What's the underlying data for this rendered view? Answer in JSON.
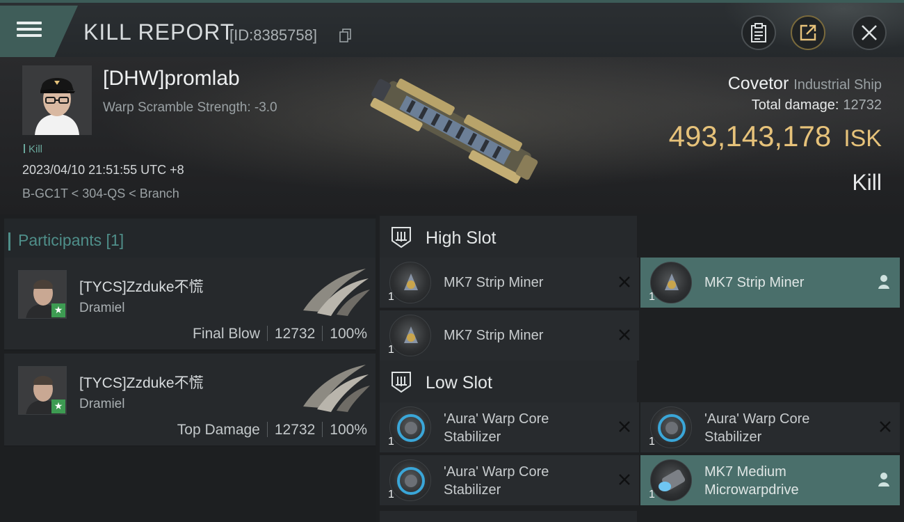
{
  "header": {
    "title": "KILL REPORT",
    "id_label": "[ID:8385758]"
  },
  "victim": {
    "name": "[DHW]promlab",
    "subtitle": "Warp Scramble Strength: -3.0",
    "tag": "Kill",
    "timestamp": "2023/04/10 21:51:55 UTC +8",
    "location": "B-GC1T < 304-QS < Branch",
    "ship_name": "Covetor",
    "ship_class": "Industrial Ship",
    "total_damage_label": "Total damage:",
    "total_damage_value": "12732",
    "isk_value": "493,143,178",
    "isk_unit": "ISK",
    "result": "Kill"
  },
  "participants": {
    "title": "Participants [1]",
    "items": [
      {
        "name": "[TYCS]Zzduke不慌",
        "ship": "Dramiel",
        "role": "Final Blow",
        "damage": "12732",
        "percent": "100%"
      },
      {
        "name": "[TYCS]Zzduke不慌",
        "ship": "Dramiel",
        "role": "Top Damage",
        "damage": "12732",
        "percent": "100%"
      }
    ]
  },
  "fitting": {
    "high_slot": {
      "label": "High Slot",
      "modules": [
        {
          "qty": "1",
          "name_line1": "MK7 Strip Miner",
          "name_line2": "",
          "status": "destroyed"
        },
        {
          "qty": "1",
          "name_line1": "MK7 Strip Miner",
          "name_line2": "",
          "status": "dropped"
        },
        {
          "qty": "1",
          "name_line1": "MK7 Strip Miner",
          "name_line2": "",
          "status": "destroyed"
        }
      ]
    },
    "low_slot": {
      "label": "Low Slot",
      "modules": [
        {
          "qty": "1",
          "name_line1": "'Aura' Warp Core",
          "name_line2": "Stabilizer",
          "status": "destroyed"
        },
        {
          "qty": "1",
          "name_line1": "'Aura' Warp Core",
          "name_line2": "Stabilizer",
          "status": "destroyed"
        },
        {
          "qty": "1",
          "name_line1": "'Aura' Warp Core",
          "name_line2": "Stabilizer",
          "status": "destroyed"
        },
        {
          "qty": "1",
          "name_line1": "MK7 Medium",
          "name_line2": "Microwarpdrive",
          "status": "dropped"
        }
      ]
    }
  },
  "icons": {
    "menu": "hamburger-icon",
    "copy": "copy-icon",
    "clipboard": "clipboard-icon",
    "share": "share-icon",
    "close": "close-icon",
    "destroyed": "x-icon",
    "dropped": "person-icon",
    "high_slot": "high-slot-icon",
    "low_slot": "low-slot-icon"
  },
  "colors": {
    "accent_teal": "#4f8f8a",
    "isk_gold": "#e6c27a",
    "dropped_highlight": "#4a6f6b",
    "star_green": "#3d9b52"
  }
}
